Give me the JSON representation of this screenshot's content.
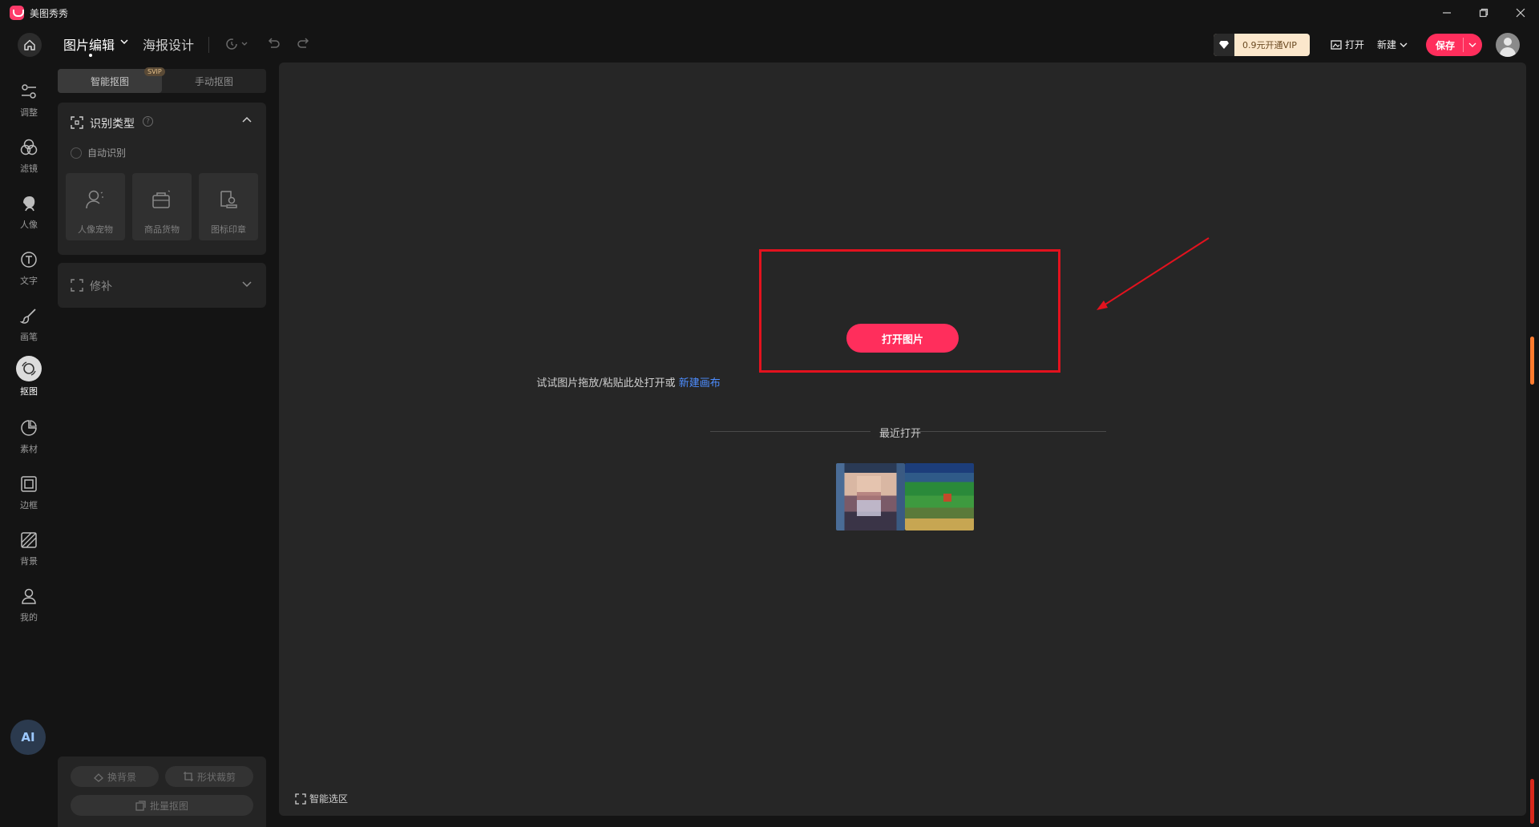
{
  "app": {
    "title": "美图秀秀"
  },
  "toolbar": {
    "tab_photo": "图片编辑",
    "tab_poster": "海报设计",
    "vip_label": "0.9元开通VIP",
    "open_label": "打开",
    "new_label": "新建",
    "save_label": "保存"
  },
  "rail": {
    "items": [
      {
        "label": "调整",
        "icon": "sliders-icon"
      },
      {
        "label": "滤镜",
        "icon": "filter-icon"
      },
      {
        "label": "人像",
        "icon": "portrait-icon"
      },
      {
        "label": "文字",
        "icon": "text-icon"
      },
      {
        "label": "画笔",
        "icon": "brush-icon"
      },
      {
        "label": "抠图",
        "icon": "cutout-icon"
      },
      {
        "label": "素材",
        "icon": "sticker-icon"
      },
      {
        "label": "边框",
        "icon": "frame-icon"
      },
      {
        "label": "背景",
        "icon": "background-icon"
      },
      {
        "label": "我的",
        "icon": "user-icon"
      }
    ],
    "active": "抠图",
    "ai_label": "AI"
  },
  "panel": {
    "segments": {
      "smart": "智能抠图",
      "smart_badge": "SVIP",
      "manual": "手动抠图"
    },
    "type_card": {
      "title": "识别类型",
      "help": "?",
      "auto_label": "自动识别",
      "tiles": [
        {
          "label": "人像宠物"
        },
        {
          "label": "商品货物"
        },
        {
          "label": "图标印章"
        }
      ]
    },
    "repair_label": "修补",
    "bottom": {
      "swap_bg": "换背景",
      "shape_crop": "形状裁剪",
      "batch": "批量抠图"
    }
  },
  "canvas": {
    "open_button": "打开图片",
    "hint": "试试图片拖放/粘贴此处打开或",
    "hint_link": "新建画布",
    "recent_title": "最近打开",
    "smart_select": "智能选区"
  },
  "colors": {
    "accent": "#ff2e5c",
    "link": "#4d8dff",
    "annotation": "#e3121e"
  }
}
